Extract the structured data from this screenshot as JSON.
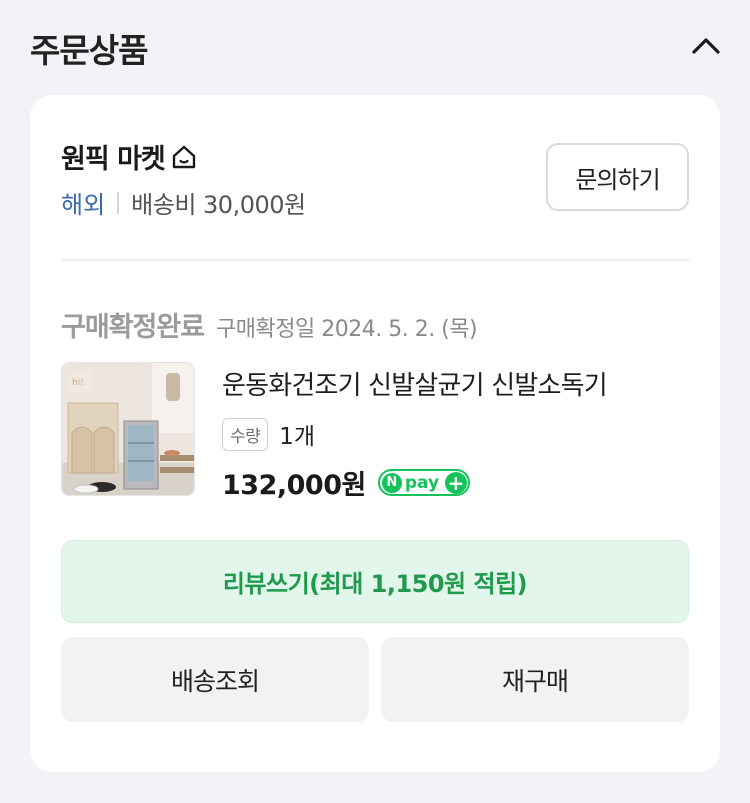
{
  "section": {
    "title": "주문상품"
  },
  "store": {
    "name": "원픽 마켓",
    "origin": "해외",
    "shipping": "배송비 30,000원",
    "inquiry_label": "문의하기"
  },
  "order": {
    "status": "구매확정완료",
    "confirm_date": "구매확정일 2024. 5. 2. (목)"
  },
  "product": {
    "name": "운동화건조기 신발살균기 신발소독기",
    "qty_label": "수량",
    "qty_value": "1개",
    "price": "132,000원",
    "npay_text": "pay"
  },
  "actions": {
    "review_label": "리뷰쓰기(최대 1,150원 적립)",
    "track_label": "배송조회",
    "rebuy_label": "재구매"
  },
  "colors": {
    "accent_green": "#1f9a4c",
    "npay_green": "#16c25a",
    "origin_blue": "#3a6ab0"
  },
  "icons": {
    "collapse": "chevron-up-icon",
    "store_home": "home-icon"
  }
}
